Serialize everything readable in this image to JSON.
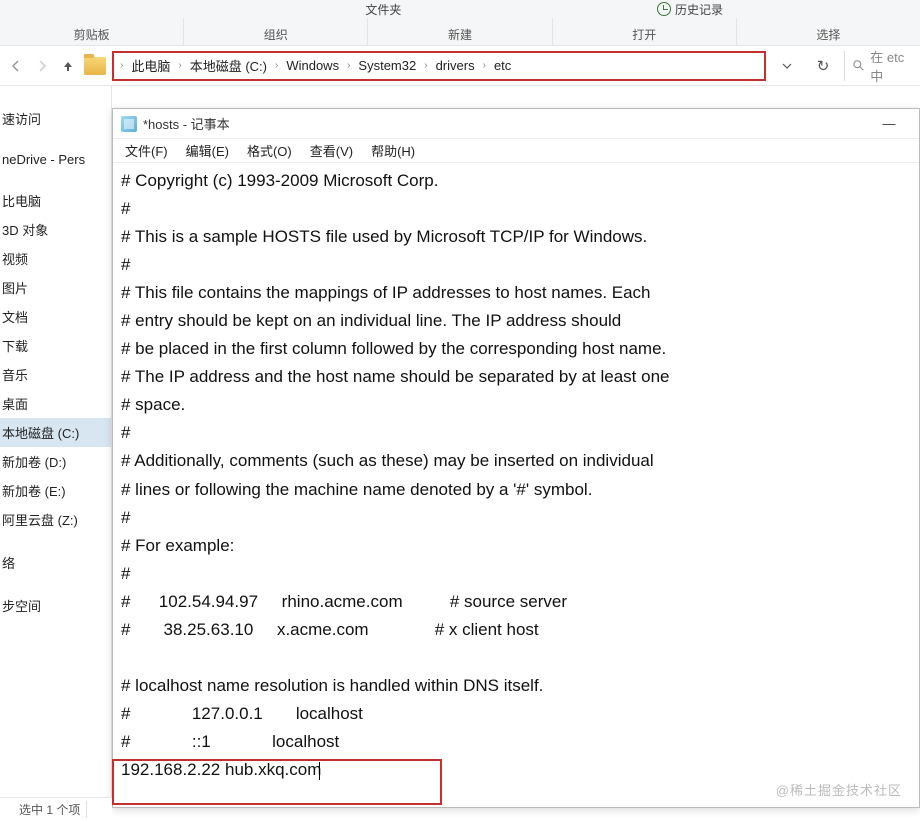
{
  "ribbon": {
    "top_items": {
      "folder": "文件夹",
      "history": "历史记录",
      "unknown": ""
    },
    "groups": {
      "clipboard": "剪贴板",
      "organize": "组织",
      "new": "新建",
      "open": "打开",
      "select": "选择"
    }
  },
  "breadcrumb": {
    "items": [
      "此电脑",
      "本地磁盘 (C:)",
      "Windows",
      "System32",
      "drivers",
      "etc"
    ]
  },
  "search": {
    "placeholder": "在 etc 中"
  },
  "sidebar": {
    "items": [
      {
        "label": "速访问",
        "selected": false
      },
      {
        "label": "",
        "spacer": true
      },
      {
        "label": "neDrive - Pers",
        "selected": false
      },
      {
        "label": "",
        "spacer": true
      },
      {
        "label": "比电脑",
        "selected": false
      },
      {
        "label": "3D 对象",
        "selected": false
      },
      {
        "label": "视频",
        "selected": false
      },
      {
        "label": "图片",
        "selected": false
      },
      {
        "label": "文档",
        "selected": false
      },
      {
        "label": "下载",
        "selected": false
      },
      {
        "label": "音乐",
        "selected": false
      },
      {
        "label": "桌面",
        "selected": false
      },
      {
        "label": "本地磁盘 (C:)",
        "selected": true
      },
      {
        "label": "新加卷 (D:)",
        "selected": false
      },
      {
        "label": "新加卷 (E:)",
        "selected": false
      },
      {
        "label": "阿里云盘 (Z:)",
        "selected": false
      },
      {
        "label": "",
        "spacer": true
      },
      {
        "label": "络",
        "selected": false
      },
      {
        "label": "",
        "spacer": true
      },
      {
        "label": "步空间",
        "selected": false
      }
    ]
  },
  "notepad": {
    "title": "*hosts - 记事本",
    "menus": [
      "文件(F)",
      "编辑(E)",
      "格式(O)",
      "查看(V)",
      "帮助(H)"
    ],
    "content_lines": [
      "# Copyright (c) 1993-2009 Microsoft Corp.",
      "#",
      "# This is a sample HOSTS file used by Microsoft TCP/IP for Windows.",
      "#",
      "# This file contains the mappings of IP addresses to host names. Each",
      "# entry should be kept on an individual line. The IP address should",
      "# be placed in the first column followed by the corresponding host name.",
      "# The IP address and the host name should be separated by at least one",
      "# space.",
      "#",
      "# Additionally, comments (such as these) may be inserted on individual",
      "# lines or following the machine name denoted by a '#' symbol.",
      "#",
      "# For example:",
      "#",
      "#      102.54.94.97     rhino.acme.com          # source server",
      "#       38.25.63.10     x.acme.com              # x client host",
      "",
      "# localhost name resolution is handled within DNS itself.",
      "#             127.0.0.1       localhost",
      "#             ::1             localhost",
      "192.168.2.22 hub.xkq.com"
    ]
  },
  "statusbar": {
    "count": "",
    "selected": "选中 1 个项"
  },
  "watermark": "@稀土掘金技术社区"
}
